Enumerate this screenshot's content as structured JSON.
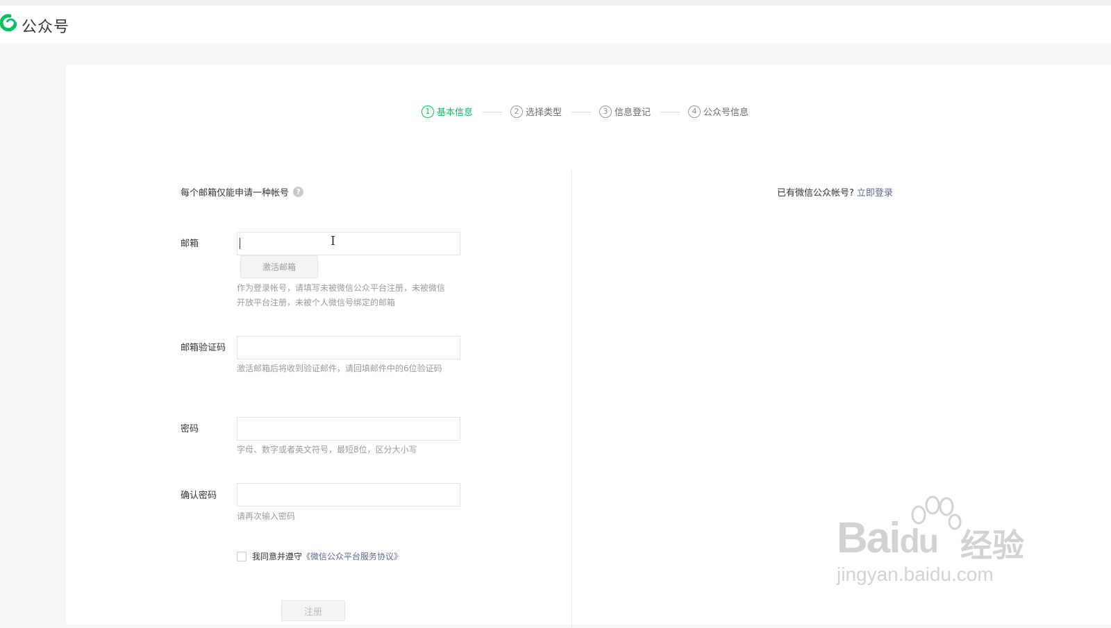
{
  "header": {
    "app_title": "公众号",
    "logo_icon": "wechat-mp-logo-icon",
    "brand_color": "#07c160"
  },
  "steps": [
    {
      "num": "1",
      "label": "基本信息",
      "active": true
    },
    {
      "num": "2",
      "label": "选择类型",
      "active": false
    },
    {
      "num": "3",
      "label": "信息登记",
      "active": false
    },
    {
      "num": "4",
      "label": "公众号信息",
      "active": false
    }
  ],
  "form": {
    "note": "每个邮箱仅能申请一种帐号",
    "email": {
      "label": "邮箱",
      "value": "",
      "activate_button": "激活邮箱",
      "tip": "作为登录帐号，请填写未被微信公众平台注册，未被微信开放平台注册，未被个人微信号绑定的邮箱"
    },
    "verify_code": {
      "label": "邮箱验证码",
      "value": "",
      "tip": "激活邮箱后将收到验证邮件，请回填邮件中的6位验证码"
    },
    "password": {
      "label": "密码",
      "value": "",
      "tip": "字母、数字或者英文符号，最短8位，区分大小写"
    },
    "confirm_password": {
      "label": "确认密码",
      "value": "",
      "tip": "请再次输入密码"
    },
    "agreement": {
      "prefix": "我同意并遵守",
      "link": "《微信公众平台服务协议》",
      "checked": false
    },
    "register_button": "注册"
  },
  "login_hint": {
    "text": "已有微信公众帐号?",
    "link": "立即登录"
  },
  "watermark": {
    "brand": "Bai",
    "brand2": "du",
    "cn": "经验",
    "url": "jingyan.baidu.com"
  }
}
